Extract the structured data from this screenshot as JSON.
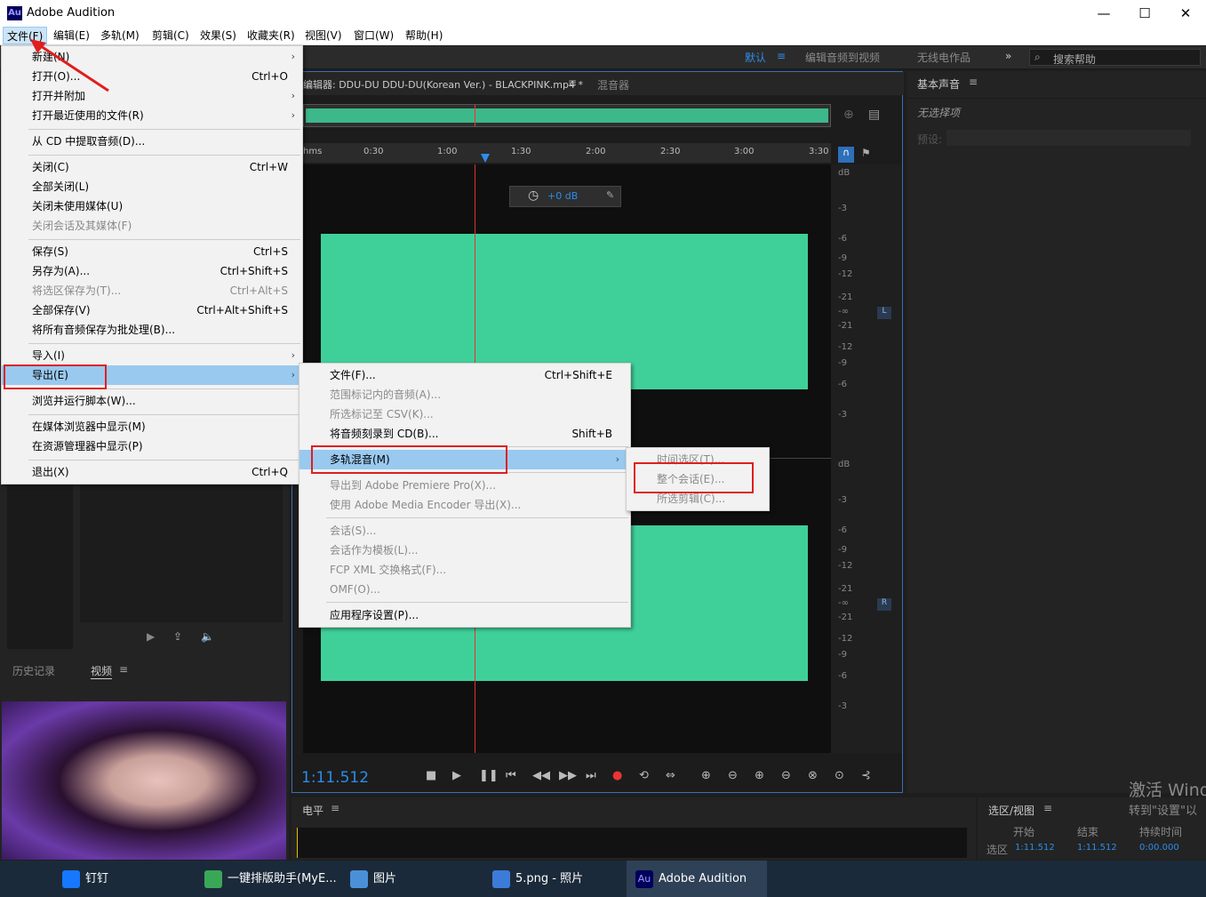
{
  "window": {
    "title": "Adobe Audition",
    "logo_text": "Au",
    "min": "—",
    "max": "☐",
    "close": "✕"
  },
  "menubar": [
    "文件(F)",
    "编辑(E)",
    "多轨(M)",
    "剪辑(C)",
    "效果(S)",
    "收藏夹(R)",
    "视图(V)",
    "窗口(W)",
    "帮助(H)"
  ],
  "toolbar": {
    "workspace_default": "默认",
    "ws_edit_video": "编辑音频到视频",
    "ws_radio": "无线电作品",
    "more": "»",
    "search_placeholder": "搜索帮助"
  },
  "editor": {
    "tab_label": "编辑器: DDU-DU DDU-DU(Korean Ver.) - BLACKPINK.mp4 *",
    "tab_mixer": "混音器",
    "ruler_ticks": [
      "hms",
      "0:30",
      "1:00",
      "1:30",
      "2:00",
      "2:30",
      "3:00",
      "3:30"
    ],
    "gain": "+0 dB",
    "db_labels_top": [
      "dB",
      "-3",
      "-6",
      "-9",
      "-12",
      "-21",
      "-∞",
      "-21",
      "-12",
      "-9",
      "-6",
      "-3"
    ],
    "db_labels_bottom": [
      "dB",
      "-3",
      "-6",
      "-9",
      "-12",
      "-21",
      "-∞",
      "-21",
      "-12",
      "-9",
      "-6",
      "-3"
    ],
    "channel_l": "L",
    "channel_r": "R",
    "time": "1:11.512"
  },
  "right_panel": {
    "title": "基本声音",
    "no_selection": "无选择项",
    "preset_label": "预设:"
  },
  "left_lower": {
    "tab_history": "历史记录",
    "tab_video": "视频"
  },
  "levels": {
    "title": "电平"
  },
  "selview": {
    "title": "选区/视图",
    "col_start": "开始",
    "col_end": "结束",
    "col_duration": "持续时间",
    "row_label": "选区",
    "start": "1:11.512",
    "end": "1:11.512",
    "duration": "0:00.000"
  },
  "watermark": {
    "line1": "激活 Wind",
    "line2": "转到\"设置\"以"
  },
  "file_menu": [
    {
      "label": "新建(N)",
      "arrow": "›"
    },
    {
      "label": "打开(O)...",
      "shortcut": "Ctrl+O"
    },
    {
      "label": "打开并附加",
      "arrow": "›"
    },
    {
      "label": "打开最近使用的文件(R)",
      "arrow": "›"
    },
    {
      "label": "从 CD 中提取音频(D)..."
    },
    {
      "label": "关闭(C)",
      "shortcut": "Ctrl+W"
    },
    {
      "label": "全部关闭(L)"
    },
    {
      "label": "关闭未使用媒体(U)"
    },
    {
      "label": "关闭会话及其媒体(F)",
      "disabled": true
    },
    {
      "label": "保存(S)",
      "shortcut": "Ctrl+S"
    },
    {
      "label": "另存为(A)...",
      "shortcut": "Ctrl+Shift+S"
    },
    {
      "label": "将选区保存为(T)...",
      "shortcut": "Ctrl+Alt+S",
      "disabled": true
    },
    {
      "label": "全部保存(V)",
      "shortcut": "Ctrl+Alt+Shift+S"
    },
    {
      "label": "将所有音频保存为批处理(B)..."
    },
    {
      "label": "导入(I)",
      "arrow": "›"
    },
    {
      "label": "导出(E)",
      "arrow": "›"
    },
    {
      "label": "浏览并运行脚本(W)..."
    },
    {
      "label": "在媒体浏览器中显示(M)"
    },
    {
      "label": "在资源管理器中显示(P)"
    },
    {
      "label": "退出(X)",
      "shortcut": "Ctrl+Q"
    }
  ],
  "export_menu": [
    {
      "label": "文件(F)...",
      "shortcut": "Ctrl+Shift+E"
    },
    {
      "label": "范围标记内的音频(A)...",
      "disabled": true
    },
    {
      "label": "所选标记至 CSV(K)...",
      "disabled": true
    },
    {
      "label": "将音频刻录到 CD(B)...",
      "shortcut": "Shift+B"
    },
    {
      "label": "多轨混音(M)",
      "arrow": "›"
    },
    {
      "label": "导出到 Adobe Premiere Pro(X)...",
      "disabled": true
    },
    {
      "label": "使用 Adobe Media Encoder 导出(X)...",
      "disabled": true
    },
    {
      "label": "会话(S)...",
      "disabled": true
    },
    {
      "label": "会话作为模板(L)...",
      "disabled": true
    },
    {
      "label": "FCP XML 交换格式(F)...",
      "disabled": true
    },
    {
      "label": "OMF(O)...",
      "disabled": true
    },
    {
      "label": "应用程序设置(P)..."
    }
  ],
  "mix_menu": [
    {
      "label": "时间选区(T)...",
      "disabled": true
    },
    {
      "label": "整个会话(E)...",
      "disabled": true
    },
    {
      "label": "所选剪辑(C)...",
      "disabled": true
    }
  ],
  "taskbar": [
    {
      "label": "钉钉",
      "color": "#1677ff"
    },
    {
      "label": "一键排版助手(MyE...",
      "color": "#3aa757"
    },
    {
      "label": "图片",
      "color": "#4a90d9"
    },
    {
      "label": "5.png - 照片",
      "color": "#3d7bd9"
    },
    {
      "label": "Adobe Audition",
      "color": "#00005b"
    }
  ],
  "colors": {
    "waveform": "#3fd09a",
    "accent": "#2d8ceb",
    "highlight": "#99c9ef",
    "annotation": "#e01e1e"
  }
}
